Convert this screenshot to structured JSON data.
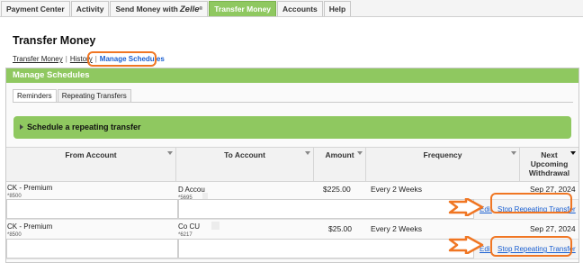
{
  "nav": {
    "tabs": [
      {
        "label": "Payment Center"
      },
      {
        "label": "Activity"
      },
      {
        "label": "Send Money with",
        "brand": "Zelle",
        "brand_sup": "®"
      },
      {
        "label": "Transfer Money"
      },
      {
        "label": "Accounts"
      },
      {
        "label": "Help"
      }
    ],
    "active_tab": "Transfer Money"
  },
  "page": {
    "title": "Transfer Money",
    "subnav": {
      "transfer_money": "Transfer Money",
      "separator": "|",
      "history": "History",
      "manage_schedules": "Manage Schedules"
    }
  },
  "panel": {
    "title": "Manage Schedules",
    "subtabs": {
      "reminders": "Reminders",
      "repeating": "Repeating Transfers"
    },
    "repeat_bar": "Schedule a repeating transfer"
  },
  "table": {
    "headers": {
      "from": "From Account",
      "to": "To Account",
      "amount": "Amount",
      "frequency": "Frequency",
      "next": [
        "Next",
        "Upcoming",
        "Withdrawal"
      ]
    },
    "rows": [
      {
        "from_name": "CK - Premium",
        "from_num": "*8500",
        "to_name": "D  Accou",
        "to_num": "*5695",
        "amount": "$225.00",
        "frequency": "Every 2 Weeks",
        "next": "Sep 27, 2024",
        "edit": "Edit",
        "stop": "Stop Repeating Transfer"
      },
      {
        "from_name": "CK - Premium",
        "from_num": "*8500",
        "to_name": "Co CU",
        "to_num": "*6217",
        "amount": "$25.00",
        "frequency": "Every 2 Weeks",
        "next": "Sep 27, 2024",
        "edit": "Edit",
        "stop": "Stop Repeating Transfer"
      }
    ]
  },
  "colors": {
    "accent_green": "#8fc860",
    "highlight_orange": "#f07623",
    "link_blue": "#1a5fd1"
  }
}
